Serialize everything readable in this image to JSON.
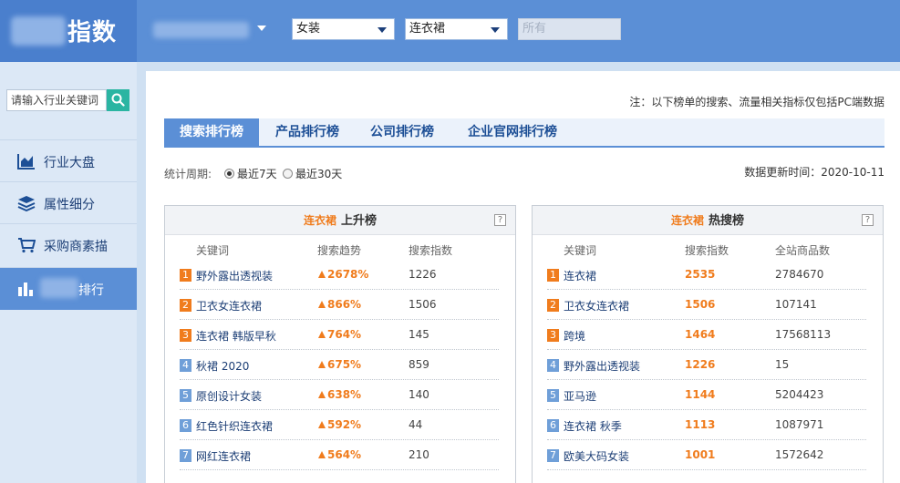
{
  "header": {
    "logo_text": "指数",
    "filters": [
      {
        "value": "女装",
        "disabled": false
      },
      {
        "value": "连衣裙",
        "disabled": false
      },
      {
        "value": "所有",
        "disabled": true
      }
    ]
  },
  "sidebar": {
    "search_placeholder": "请输入行业关键词",
    "items": [
      {
        "label": "行业大盘",
        "icon": "area-chart-icon"
      },
      {
        "label": "属性细分",
        "icon": "layers-icon"
      },
      {
        "label": "采购商素描",
        "icon": "shopping-cart-icon"
      },
      {
        "label": "排行",
        "icon": "bar-chart-icon",
        "active": true
      }
    ]
  },
  "main": {
    "note": "注：以下榜单的搜索、流量相关指标仅包括PC端数据",
    "tabs": [
      {
        "label": "搜索排行榜",
        "active": true
      },
      {
        "label": "产品排行榜"
      },
      {
        "label": "公司排行榜"
      },
      {
        "label": "企业官网排行榜"
      }
    ],
    "period": {
      "label": "统计周期:",
      "options": [
        {
          "label": "最近7天",
          "selected": true
        },
        {
          "label": "最近30天",
          "selected": false
        }
      ]
    },
    "update_text": "数据更新时间：2020-10-11"
  },
  "rising_panel": {
    "highlight": "连衣裙",
    "title": "上升榜",
    "help": "?",
    "columns": [
      "关键词",
      "搜索趋势",
      "搜索指数"
    ],
    "rows": [
      {
        "rank": "1",
        "keyword": "野外露出透视装",
        "trend": "2678%",
        "index": "1226"
      },
      {
        "rank": "2",
        "keyword": "卫衣女连衣裙",
        "trend": "866%",
        "index": "1506"
      },
      {
        "rank": "3",
        "keyword": "连衣裙 韩版早秋",
        "trend": "764%",
        "index": "145"
      },
      {
        "rank": "4",
        "keyword": "秋裙 2020",
        "trend": "675%",
        "index": "859"
      },
      {
        "rank": "5",
        "keyword": "原创设计女装",
        "trend": "638%",
        "index": "140"
      },
      {
        "rank": "6",
        "keyword": "红色针织连衣裙",
        "trend": "592%",
        "index": "44"
      },
      {
        "rank": "7",
        "keyword": "网红连衣裙",
        "trend": "564%",
        "index": "210"
      }
    ]
  },
  "hot_panel": {
    "highlight": "连衣裙",
    "title": "热搜榜",
    "help": "?",
    "columns": [
      "关键词",
      "搜索指数",
      "全站商品数"
    ],
    "rows": [
      {
        "rank": "1",
        "keyword": "连衣裙",
        "index": "2535",
        "products": "2784670"
      },
      {
        "rank": "2",
        "keyword": "卫衣女连衣裙",
        "index": "1506",
        "products": "107141"
      },
      {
        "rank": "3",
        "keyword": "跨境",
        "index": "1464",
        "products": "17568113"
      },
      {
        "rank": "4",
        "keyword": "野外露出透视装",
        "index": "1226",
        "products": "15"
      },
      {
        "rank": "5",
        "keyword": "亚马逊",
        "index": "1144",
        "products": "5204423"
      },
      {
        "rank": "6",
        "keyword": "连衣裙 秋季",
        "index": "1113",
        "products": "1087971"
      },
      {
        "rank": "7",
        "keyword": "欧美大码女装",
        "index": "1001",
        "products": "1572642"
      }
    ]
  },
  "colors": {
    "primary": "#5b8fd6",
    "accent": "#f07c1d",
    "search_button": "#2bb5a2"
  }
}
